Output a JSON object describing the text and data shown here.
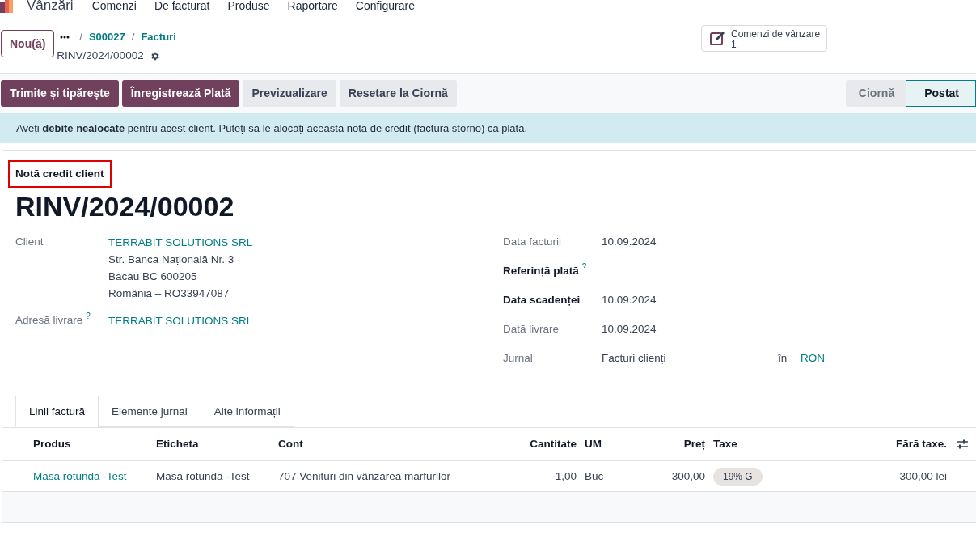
{
  "nav": {
    "app": "Vânzări",
    "menus": [
      "Comenzi",
      "De facturat",
      "Produse",
      "Raportare",
      "Configurare"
    ]
  },
  "new_button": "Nou(ă)",
  "breadcrumbs": [
    {
      "text": "/",
      "kind": "separator"
    },
    {
      "text": "S00027",
      "kind": "link"
    },
    {
      "text": "/",
      "kind": "separator"
    },
    {
      "text": "Facturi",
      "kind": "link"
    }
  ],
  "record_name": "RINV/2024/00002",
  "smart_button": {
    "label": "Comenzi de vânzare",
    "count": "1"
  },
  "action_buttons": [
    {
      "label": "Trimite și tipărește",
      "kind": "primary"
    },
    {
      "label": "Înregistrează Plată",
      "kind": "primary"
    },
    {
      "label": "Previzualizare",
      "kind": "secondary"
    },
    {
      "label": "Resetare la Ciornă",
      "kind": "secondary"
    }
  ],
  "status_steps": [
    {
      "label": "Ciornă",
      "selected": false
    },
    {
      "label": "Postat",
      "selected": true
    }
  ],
  "alert": "Aveți **debite nealocate** pentru acest client. Puteți să le alocați această notă de credit (factura storno) ca plată.",
  "document_type": "Notă credit client",
  "title": "RINV/2024/00002",
  "left_fields": [
    {
      "label": "Client",
      "lines": [
        {
          "text": "TERRABIT SOLUTIONS SRL",
          "kind": "link"
        },
        {
          "text": "Str. Banca Națională Nr. 3",
          "kind": "text"
        },
        {
          "text": "Bacau BC 600205",
          "kind": "text"
        },
        {
          "text": "România – RO33947087",
          "kind": "text"
        }
      ]
    },
    {
      "label": "Adresă livrare",
      "help": "?",
      "lines": [
        {
          "text": "TERRABIT SOLUTIONS SRL",
          "kind": "link"
        }
      ]
    }
  ],
  "right_fields": [
    {
      "label": "Data facturii",
      "bold": false,
      "value": "10.09.2024"
    },
    {
      "label": "Referință plată",
      "bold": true,
      "help": "?"
    },
    {
      "label": "Data scadenței",
      "bold": true,
      "value": "10.09.2024"
    },
    {
      "label": "Dată livrare",
      "bold": false,
      "value": "10.09.2024"
    },
    {
      "label": "Jurnal",
      "bold": false,
      "value": "Facturi clienți",
      "joiner": "în",
      "currency": "RON"
    }
  ],
  "tabs": [
    {
      "label": "Linii factură",
      "selected": true
    },
    {
      "label": "Elemente jurnal",
      "selected": false
    },
    {
      "label": "Alte informații",
      "selected": false
    }
  ],
  "table": {
    "columns": [
      "Produs",
      "Eticheta",
      "Cont",
      "Cantitate",
      "UM",
      "Preț",
      "Taxe",
      "Fără taxe."
    ],
    "rows": [
      [
        {
          "text": "Masa rotunda -Test",
          "kind": "link"
        },
        {
          "text": "Masa rotunda -Test",
          "kind": "text"
        },
        {
          "text": "707 Venituri din vânzarea mărfurilor",
          "kind": "text"
        },
        {
          "text": "1,00",
          "kind": "text"
        },
        {
          "text": "Buc",
          "kind": "text"
        },
        {
          "text": "300,00",
          "kind": "text"
        },
        {
          "text": "19% G",
          "kind": "tag"
        },
        {
          "text": "300,00 lei",
          "kind": "text"
        }
      ]
    ]
  }
}
